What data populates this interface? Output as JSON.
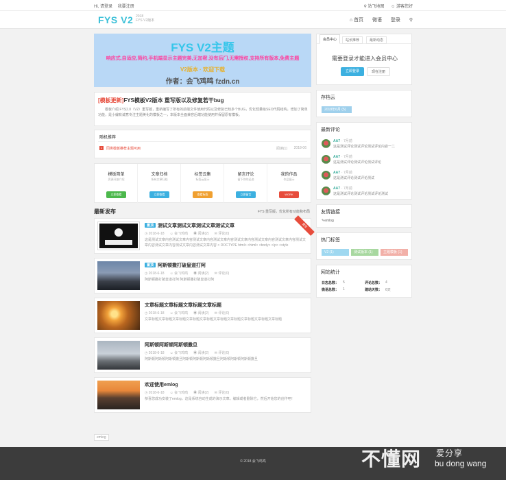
{
  "topbar": {
    "hi": "Hi, 请登录",
    "register": "我要注册",
    "sitemap": "站飞地图",
    "guest": "游客您好"
  },
  "header": {
    "logo": "FYS V2",
    "logo_sub1": "2018",
    "logo_sub2": "FYS V2版本",
    "nav_home": "首页",
    "nav_chat": "微语",
    "nav_login": "登录"
  },
  "banner": {
    "title": "FYS V2主题",
    "line1": "响应式,自适应,简约,手机端显示主题完美,无加密,没有后门,无需授权,支持所有版本,免费主题",
    "line2": "V2版本 · 欢迎下载",
    "line3": "作者：会飞鸡鸣 fzdn.cn"
  },
  "notice": {
    "label": "[模板更新]",
    "title": "FYS模板V2版本 重写版以及修复若干bug",
    "desc": "模板介绍 FYS2.0（V2）重写版，重新编写了所有的前端文件使用代码以及修复已知多个BUG，优化轻量级SEO代码结构，增加了简单功能，是小编有诚意专注主题美化的模板之一，本版本全面兼容后端功能使用并保留原有模板。"
  },
  "ranking": {
    "title": "随机推荐",
    "item": "同类模板推荐主题可用",
    "views": "阅读(1)",
    "date": "2018-06"
  },
  "features": [
    {
      "title": "模板简单",
      "sub": "资源开放介绍",
      "btn": "立即查看",
      "color": "#4cb84c"
    },
    {
      "title": "文章归档",
      "sub": "所有文章归档",
      "btn": "立即查看",
      "color": "#3cb0e0"
    },
    {
      "title": "标签云集",
      "sub": "标签云显示",
      "btn": "查看标签",
      "color": "#f0a030"
    },
    {
      "title": "留言评论",
      "sub": "留下你的足迹",
      "btn": "立即留言",
      "color": "#3cb0e0"
    },
    {
      "title": "我的作品",
      "sub": "作品展示",
      "btn": "WORK",
      "color": "#e74c3c"
    }
  ],
  "latest": {
    "title": "最新发布",
    "note": "FYS 重写版，优化所有功能和布局"
  },
  "posts": [
    {
      "tag": "置顶",
      "title": "测试文章测试文章测试文章测试文章",
      "date": "2018-6-18",
      "author": "会飞鸡鸣",
      "views": "阅读(2)",
      "comments": "评论(0)",
      "desc": "这是测试文章内容测试文章内容测试文章内容测试文章内容测试文章内容测试文章内容测试文章内容测试文章内容测试文章内容测试文章内容测试文章内容 < DOCTYPE html> <html> <body> </p> <style type=\"text/css\"> ..."
    },
    {
      "tag": "置顶",
      "title": "阿斯顿撒打破皇道打阿",
      "date": "2018-6-18",
      "author": "会飞鸡鸣",
      "views": "阅读(2)",
      "comments": "评论(0)",
      "desc": "阿斯顿撒打破皇道打阿 阿斯顿撒打破皇道打阿"
    },
    {
      "tag": "",
      "title": "文章标题文章标题文章标题文章标题",
      "date": "2018-6-18",
      "author": "会飞鸡鸣",
      "views": "阅读(2)",
      "comments": "评论(0)",
      "desc": "文章标题文章标题文章标题文章标题文章标题文章标题文章标题文章标题文章标题文章标题"
    },
    {
      "tag": "",
      "title": "阿斯顿阿斯顿阿斯顿撒旦",
      "date": "2018-6-18",
      "author": "会飞鸡鸣",
      "views": "阅读(2)",
      "comments": "评论(0)",
      "desc": "阿斯顿阿斯顿阿斯顿撒旦阿斯顿阿斯顿阿斯顿撒旦阿斯顿阿斯顿阿斯顿撒旦"
    },
    {
      "tag": "",
      "title": "欢迎使用emlog",
      "date": "2018-6-18",
      "author": "会飞鸡鸣",
      "views": "阅读(2)",
      "comments": "评论(0)",
      "desc": "恭喜您成功安装了emlog，这是系统自动生成的演示文章。编辑或者删除它，然后开始您的创作吧！"
    }
  ],
  "pager": "emlog",
  "sidebar": {
    "tabs": [
      "会员中心",
      "站长推荐",
      "最新动态"
    ],
    "login_msg": "需要登录才能进入会员中心",
    "login_btn": "立即登录",
    "reg_btn": "现在注册",
    "cloud_title": "存档云",
    "cloud_tag": "2018年6月 (5)",
    "comments_title": "最新评论",
    "comments": [
      {
        "name": "AA7",
        "time": "· 7月前",
        "text": "这是测试评论测试评论测试评论内容一二"
      },
      {
        "name": "AA7",
        "time": "· 7月前",
        "text": "这是测试评论测试评论测试评论"
      },
      {
        "name": "AA7",
        "time": "· 7月前",
        "text": "这是测试评论测试评论测试"
      },
      {
        "name": "AA7",
        "time": "· 7月前",
        "text": "这是测试评论测试评论测试评论测试"
      }
    ],
    "links_title": "友情链接",
    "link": "emlog",
    "hot_title": "热门标签",
    "hot_tags": [
      {
        "label": "V2 (1)",
        "color": "#9fd8f0"
      },
      {
        "label": "测试版本 (1)",
        "color": "#a8d8a0"
      },
      {
        "label": "主题模板 (1)",
        "color": "#f2b0a8"
      }
    ],
    "stats_title": "网站统计",
    "stats": [
      {
        "k": "日志总数：",
        "v": "5",
        "k2": "评论总数：",
        "v2": "4"
      },
      {
        "k": "微语总数：",
        "v": "1",
        "k2": "建站天数：",
        "v2": "6天"
      }
    ]
  },
  "footer": {
    "copyright": "© 2018 会飞鸡鸣"
  },
  "watermark": {
    "cn": "不懂网",
    "sub": "爱分享",
    "en": "bu dong wang"
  }
}
